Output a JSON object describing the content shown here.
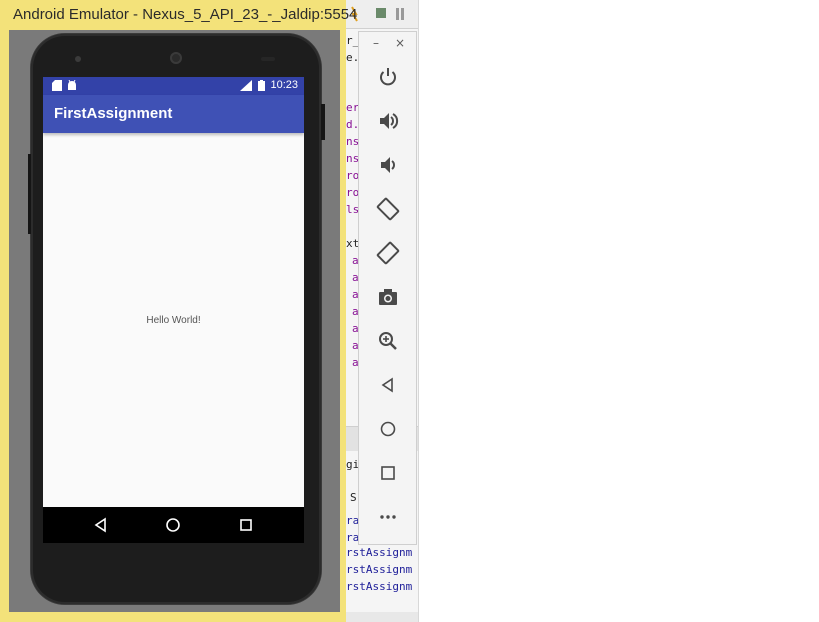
{
  "emulator": {
    "title": "Android Emulator - Nexus_5_API_23_-_Jaldip:5554",
    "status_time": "10:23",
    "app_title": "FirstAssignment",
    "content_text": "Hello World!"
  },
  "side_panel": {
    "minimize": "–",
    "close": "×",
    "controls": [
      {
        "icon": "power-icon"
      },
      {
        "icon": "volume-up-icon"
      },
      {
        "icon": "volume-down-icon"
      },
      {
        "icon": "rotate-left-icon"
      },
      {
        "icon": "rotate-right-icon"
      },
      {
        "icon": "camera-icon"
      },
      {
        "icon": "zoom-icon"
      },
      {
        "icon": "back-icon"
      },
      {
        "icon": "home-icon"
      },
      {
        "icon": "overview-icon"
      },
      {
        "icon": "more-icon"
      }
    ]
  },
  "ide_fragments": {
    "lines": [
      "r_",
      "e.x",
      "er",
      "d.",
      "ns",
      "ns",
      "ro",
      "ro",
      "ls",
      "xt",
      "a",
      "a",
      "a",
      "a",
      "a",
      "a",
      "a",
      "gi",
      "S",
      "ra",
      "ra",
      "rstAssignm",
      "rstAssignm",
      "rstAssignm"
    ]
  },
  "colors": {
    "window_frame": "#f3e27a",
    "status_bar": "#3342a8",
    "app_bar": "#3f51b5"
  }
}
